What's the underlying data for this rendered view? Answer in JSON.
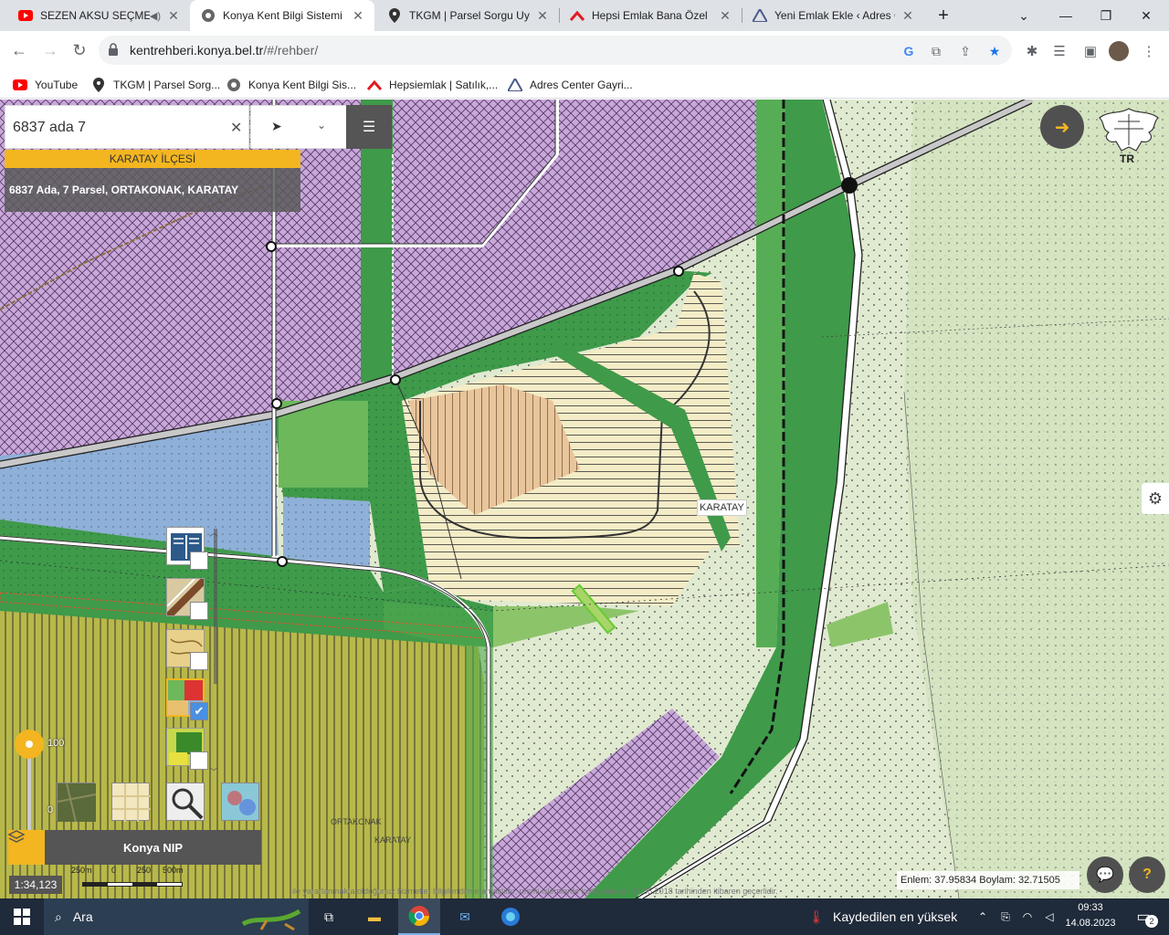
{
  "browser": {
    "tabs": [
      {
        "title": "SEZEN AKSU SEÇME Ş",
        "icon": "youtube-icon",
        "active": false
      },
      {
        "title": "Konya Kent Bilgi Sistemi",
        "icon": "konya-logo-icon",
        "active": true
      },
      {
        "title": "TKGM | Parsel Sorgu Uygu",
        "icon": "location-pin-icon",
        "active": false
      },
      {
        "title": "Hepsi Emlak Bana Özel",
        "icon": "hepsiemlak-icon",
        "active": false
      },
      {
        "title": "Yeni Emlak Ekle ‹ Adres Ce",
        "icon": "adres-center-icon",
        "active": false
      }
    ],
    "url_host": "kentrehberi.konya.bel.tr",
    "url_path": "/#/rehber/",
    "bookmarks": [
      {
        "label": "YouTube",
        "icon": "youtube-icon"
      },
      {
        "label": "TKGM | Parsel Sorg...",
        "icon": "location-pin-icon"
      },
      {
        "label": "Konya Kent Bilgi Sis...",
        "icon": "konya-logo-icon"
      },
      {
        "label": "Hepsiemlak | Satılık,...",
        "icon": "hepsiemlak-icon"
      },
      {
        "label": "Adres Center Gayri...",
        "icon": "adres-center-icon"
      }
    ]
  },
  "map": {
    "search_value": "6837 ada 7",
    "district": "KARATAY İLÇESİ",
    "result": "6837 Ada, 7 Parsel, ORTAKONAK, KARATAY",
    "place_label": "KARATAY",
    "faint_labels": [
      "ORTAKONAK",
      "KARATAY"
    ],
    "emblem_text": "TR",
    "coords": "Enlem: 37.95834 Boylam: 32.71505",
    "opacity_max": "100",
    "opacity_min": "0",
    "layers_title": "Konya NIP",
    "scale_ratio": "1:34,123",
    "scale_ticks": [
      "250m",
      "0",
      "250",
      "500m"
    ],
    "footer_note": "ile yararlanmakta olduğunuz hizmetler bilgilendirme amaçlıdır, resmi işlemlerde kullanılamaz. 17.05.2018 tarihinden itibaren geçerlidir.",
    "layer_checks": [
      false,
      false,
      false,
      true,
      false
    ]
  },
  "taskbar": {
    "search_placeholder": "Ara",
    "weather_text": "Kaydedilen en yüksek",
    "time": "09:33",
    "date": "14.08.2023",
    "notif_count": "2"
  }
}
